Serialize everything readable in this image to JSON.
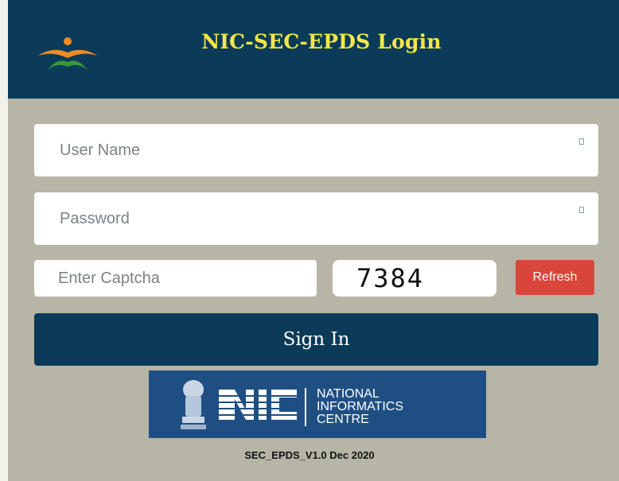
{
  "header": {
    "title": "NIC-SEC-EPDS Login",
    "logo_icon": "flame-logo-icon"
  },
  "form": {
    "username_placeholder": "User Name",
    "password_placeholder": "Password",
    "captcha_placeholder": "Enter Captcha",
    "captcha_code": "7384",
    "refresh_label": "Refresh",
    "signin_label": "Sign In"
  },
  "footer": {
    "nic_line1": "NATIONAL",
    "nic_line2": "INFORMATICS",
    "nic_line3": "CENTRE",
    "nic_logo_text": "NIC",
    "version": "SEC_EPDS_V1.0 Dec 2020"
  },
  "colors": {
    "header_bg": "#0b3b58",
    "title": "#f4e64a",
    "panel_bg": "#b6b5a6",
    "refresh_bg": "#d9453a",
    "nic_bg": "#1f4f82"
  }
}
